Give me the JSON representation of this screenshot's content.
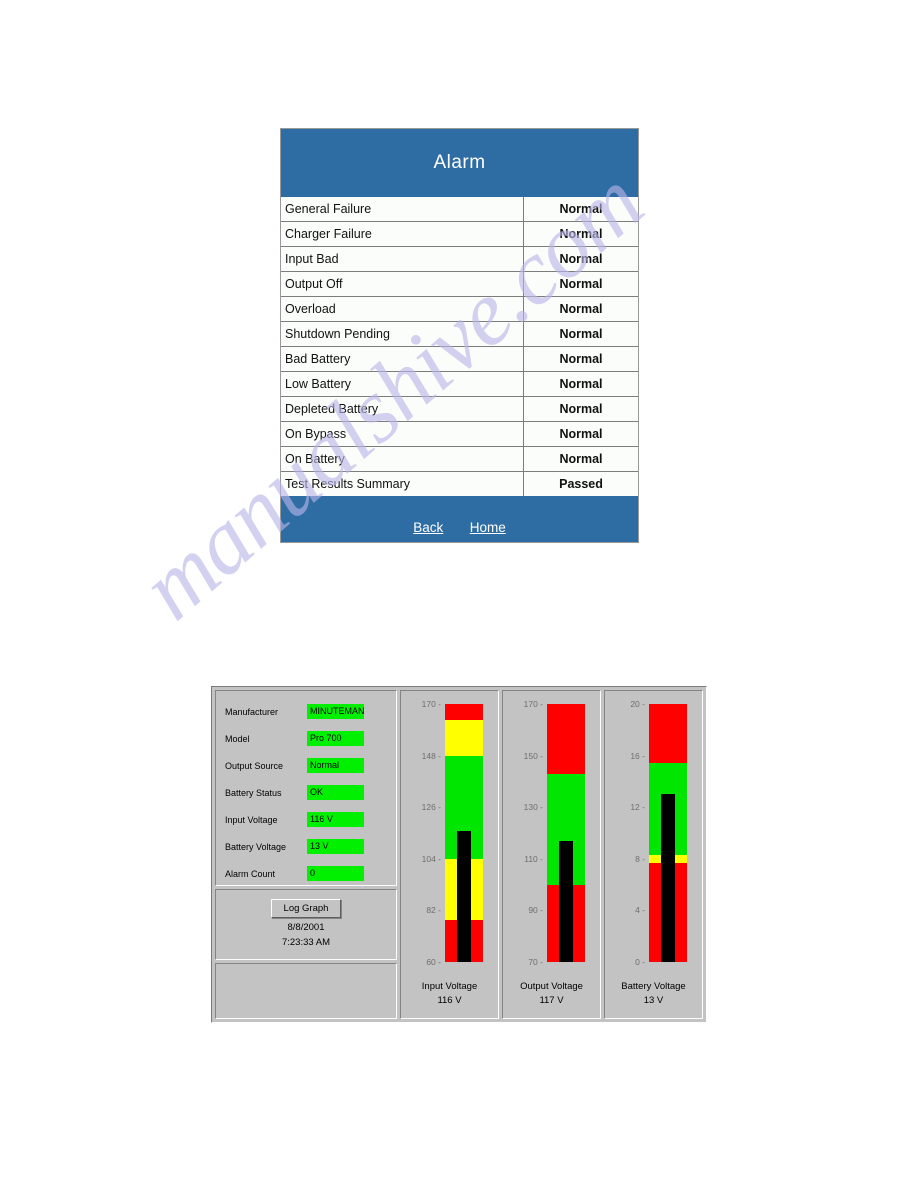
{
  "alarm": {
    "title": "Alarm",
    "rows": [
      {
        "label": "General Failure",
        "value": "Normal",
        "state": "normal"
      },
      {
        "label": "Charger Failure",
        "value": "Normal",
        "state": "normal"
      },
      {
        "label": "Input Bad",
        "value": "Normal",
        "state": "normal"
      },
      {
        "label": "Output Off",
        "value": "Normal",
        "state": "normal"
      },
      {
        "label": "Overload",
        "value": "Normal",
        "state": "normal"
      },
      {
        "label": "Shutdown Pending",
        "value": "Normal",
        "state": "normal"
      },
      {
        "label": "Bad Battery",
        "value": "Normal",
        "state": "normal"
      },
      {
        "label": "Low Battery",
        "value": "Normal",
        "state": "normal"
      },
      {
        "label": "Depleted Battery",
        "value": "Normal",
        "state": "normal"
      },
      {
        "label": "On Bypass",
        "value": "Normal",
        "state": "normal"
      },
      {
        "label": "On Battery",
        "value": "Normal",
        "state": "normal"
      },
      {
        "label": "Test Results Summary",
        "value": "Passed",
        "state": "passed"
      }
    ],
    "footer": {
      "back_label": "Back",
      "home_label": "Home"
    },
    "colors": {
      "header_blue": "#2e6da4",
      "normal_green": "#006600",
      "passed_blue": "#1b3f7a"
    }
  },
  "monitor": {
    "status": {
      "rows": [
        {
          "label": "Manufacturer",
          "value": "MINUTEMAN"
        },
        {
          "label": "Model",
          "value": "Pro 700"
        },
        {
          "label": "Output Source",
          "value": "Normal"
        },
        {
          "label": "Battery Status",
          "value": "OK"
        },
        {
          "label": "Input Voltage",
          "value": "116 V"
        },
        {
          "label": "Battery Voltage",
          "value": "13 V"
        },
        {
          "label": "Alarm Count",
          "value": "0"
        }
      ],
      "value_background": "#00f000"
    },
    "log": {
      "button_label": "Log Graph",
      "date": "8/8/2001",
      "time": "7:23:33 AM"
    }
  },
  "chart_data": [
    {
      "type": "bar",
      "title": "Input Voltage",
      "value_label": "116 V",
      "value": 116,
      "unit": "V",
      "ylim": [
        60,
        170
      ],
      "ticks": [
        170,
        148,
        126,
        104,
        82,
        60
      ],
      "zones": [
        {
          "from": 60,
          "to": 78,
          "color": "#ff0000"
        },
        {
          "from": 78,
          "to": 104,
          "color": "#ffff00"
        },
        {
          "from": 104,
          "to": 148,
          "color": "#00e600"
        },
        {
          "from": 148,
          "to": 163,
          "color": "#ffff00"
        },
        {
          "from": 163,
          "to": 170,
          "color": "#ff0000"
        }
      ],
      "needle_color": "#000000"
    },
    {
      "type": "bar",
      "title": "Output Voltage",
      "value_label": "117 V",
      "value": 117,
      "unit": "V",
      "ylim": [
        70,
        170
      ],
      "ticks": [
        170,
        150,
        130,
        110,
        90,
        70
      ],
      "zones": [
        {
          "from": 70,
          "to": 100,
          "color": "#ff0000"
        },
        {
          "from": 100,
          "to": 143,
          "color": "#00e600"
        },
        {
          "from": 143,
          "to": 170,
          "color": "#ff0000"
        }
      ],
      "needle_color": "#000000"
    },
    {
      "type": "bar",
      "title": "Battery Voltage",
      "value_label": "13 V",
      "value": 13,
      "unit": "V",
      "ylim": [
        0,
        20
      ],
      "ticks": [
        20,
        16,
        12,
        8,
        4,
        0
      ],
      "zones": [
        {
          "from": 0,
          "to": 7.7,
          "color": "#ff0000"
        },
        {
          "from": 7.7,
          "to": 8.3,
          "color": "#ffff00"
        },
        {
          "from": 8.3,
          "to": 15.4,
          "color": "#00e600"
        },
        {
          "from": 15.4,
          "to": 20,
          "color": "#ff0000"
        }
      ],
      "needle_color": "#000000"
    }
  ],
  "watermark": {
    "text": "manualshive.com"
  }
}
